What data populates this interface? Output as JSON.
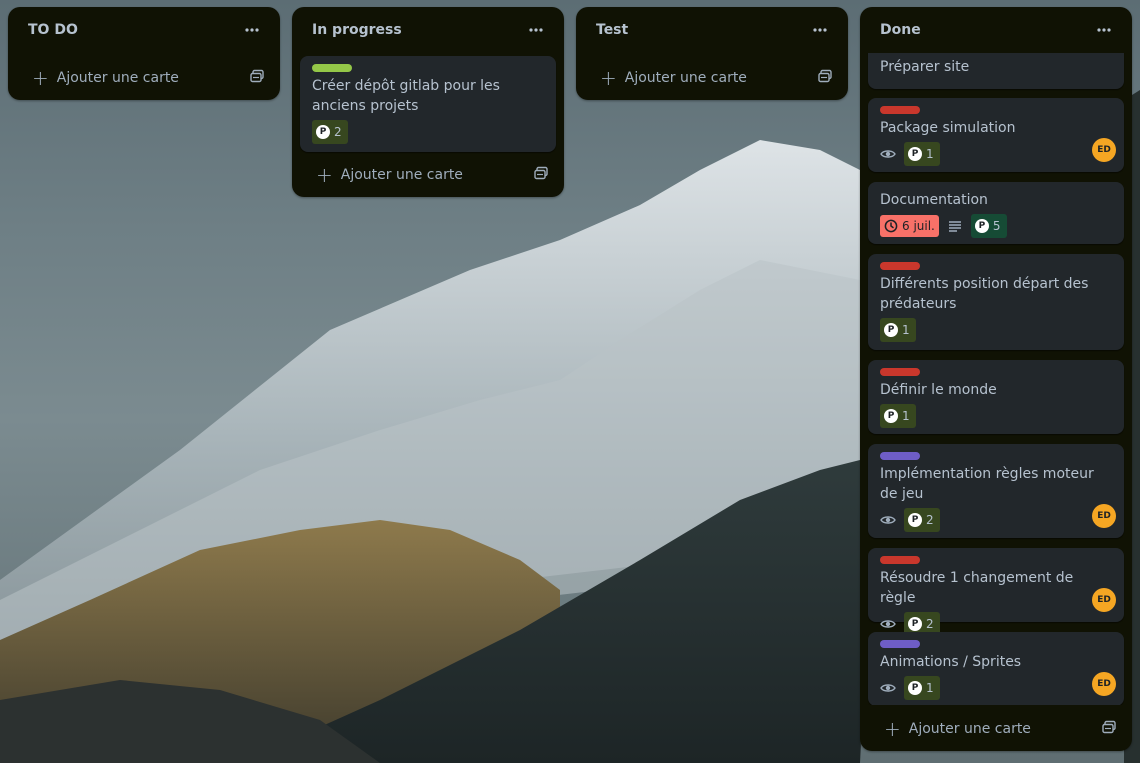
{
  "board": {
    "lists": [
      {
        "title": "TO DO",
        "add_card_label": "Ajouter une carte"
      },
      {
        "title": "In progress",
        "add_card_label": "Ajouter une carte",
        "cards": [
          {
            "label_color": "#94c748",
            "title": "Créer dépôt gitlab pour les anciens projets",
            "powerup_count": "2"
          }
        ]
      },
      {
        "title": "Test",
        "add_card_label": "Ajouter une carte"
      },
      {
        "title": "Done",
        "add_card_label": "Ajouter une carte",
        "cards": [
          {
            "label_color": "#1f845a",
            "title": "Préparer site"
          },
          {
            "label_color": "#c9372c",
            "title": "Package simulation",
            "powerup_count": "1",
            "watching": true,
            "member": "ED"
          },
          {
            "title": "Documentation",
            "due_date": "6 juil.",
            "has_description": true,
            "powerup_count": "5"
          },
          {
            "label_color": "#c9372c",
            "title": "Différents position départ des prédateurs",
            "powerup_count": "1"
          },
          {
            "label_color": "#c9372c",
            "title": "Définir le monde",
            "powerup_count": "1"
          },
          {
            "label_color": "#6e5dc6",
            "title": "Implémentation règles moteur de jeu",
            "powerup_count": "2",
            "watching": true,
            "member": "ED"
          },
          {
            "label_color": "#c9372c",
            "title": "Résoudre 1 changement de règle",
            "powerup_count": "2",
            "watching": true,
            "member": "ED"
          },
          {
            "label_color": "#6e5dc6",
            "title": "Animations / Sprites",
            "powerup_count": "1",
            "watching": true,
            "member": "ED"
          }
        ]
      }
    ]
  },
  "icons": {
    "list_menu": "ellipsis-icon",
    "add": "plus-icon",
    "template": "card-template-icon",
    "watch": "eye-icon",
    "powerup": "powerup-p-icon",
    "due": "clock-icon",
    "description": "description-icon"
  },
  "colors": {
    "list_bg": "#101204",
    "card_bg": "#22272b",
    "text": "#b6c2cf",
    "avatar": "#f5a623",
    "due_badge": "#f87168"
  },
  "powerup_letter": "P"
}
